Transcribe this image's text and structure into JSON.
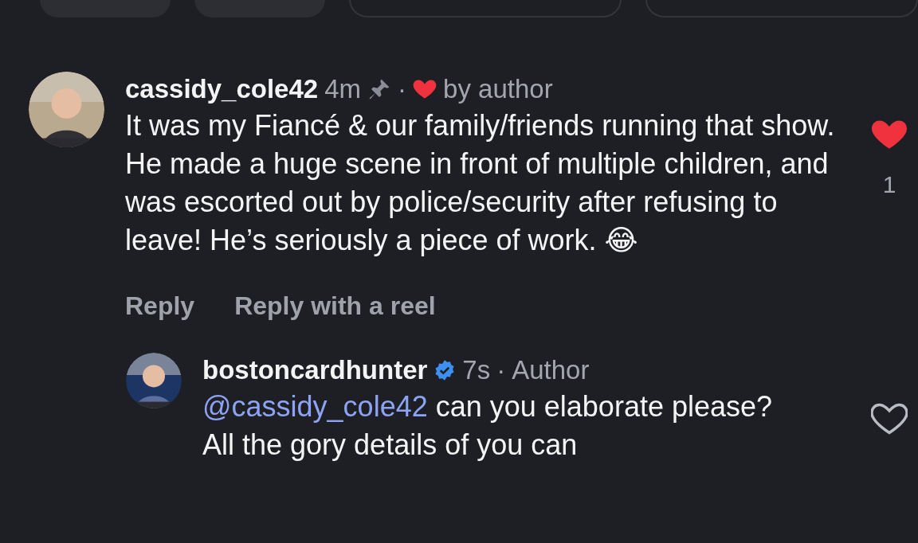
{
  "filter_pills": [
    {
      "kind": "filled"
    },
    {
      "kind": "filled"
    },
    {
      "kind": "outlined"
    },
    {
      "kind": "outlined"
    }
  ],
  "comments": [
    {
      "username": "cassidy_cole42",
      "time": "4m",
      "pinned": true,
      "separator": "·",
      "liked_by_author": true,
      "author_label": "by author",
      "body": "It was my Fiancé & our family/friends running that show. He made a huge scene in front of multiple children, and was escorted out by police/security after refusing to leave! He’s seriously a piece of work. 😂",
      "liked": true,
      "like_count": "1",
      "actions": [
        "Reply",
        "Reply with a reel"
      ],
      "replies": [
        {
          "username": "bostoncardhunter",
          "verified": true,
          "time": "7s",
          "separator": "·",
          "author_tag": "Author",
          "mention": "@cassidy_cole42",
          "body": "can you elaborate please?  All the gory details of you can",
          "liked": false
        }
      ]
    }
  ]
}
